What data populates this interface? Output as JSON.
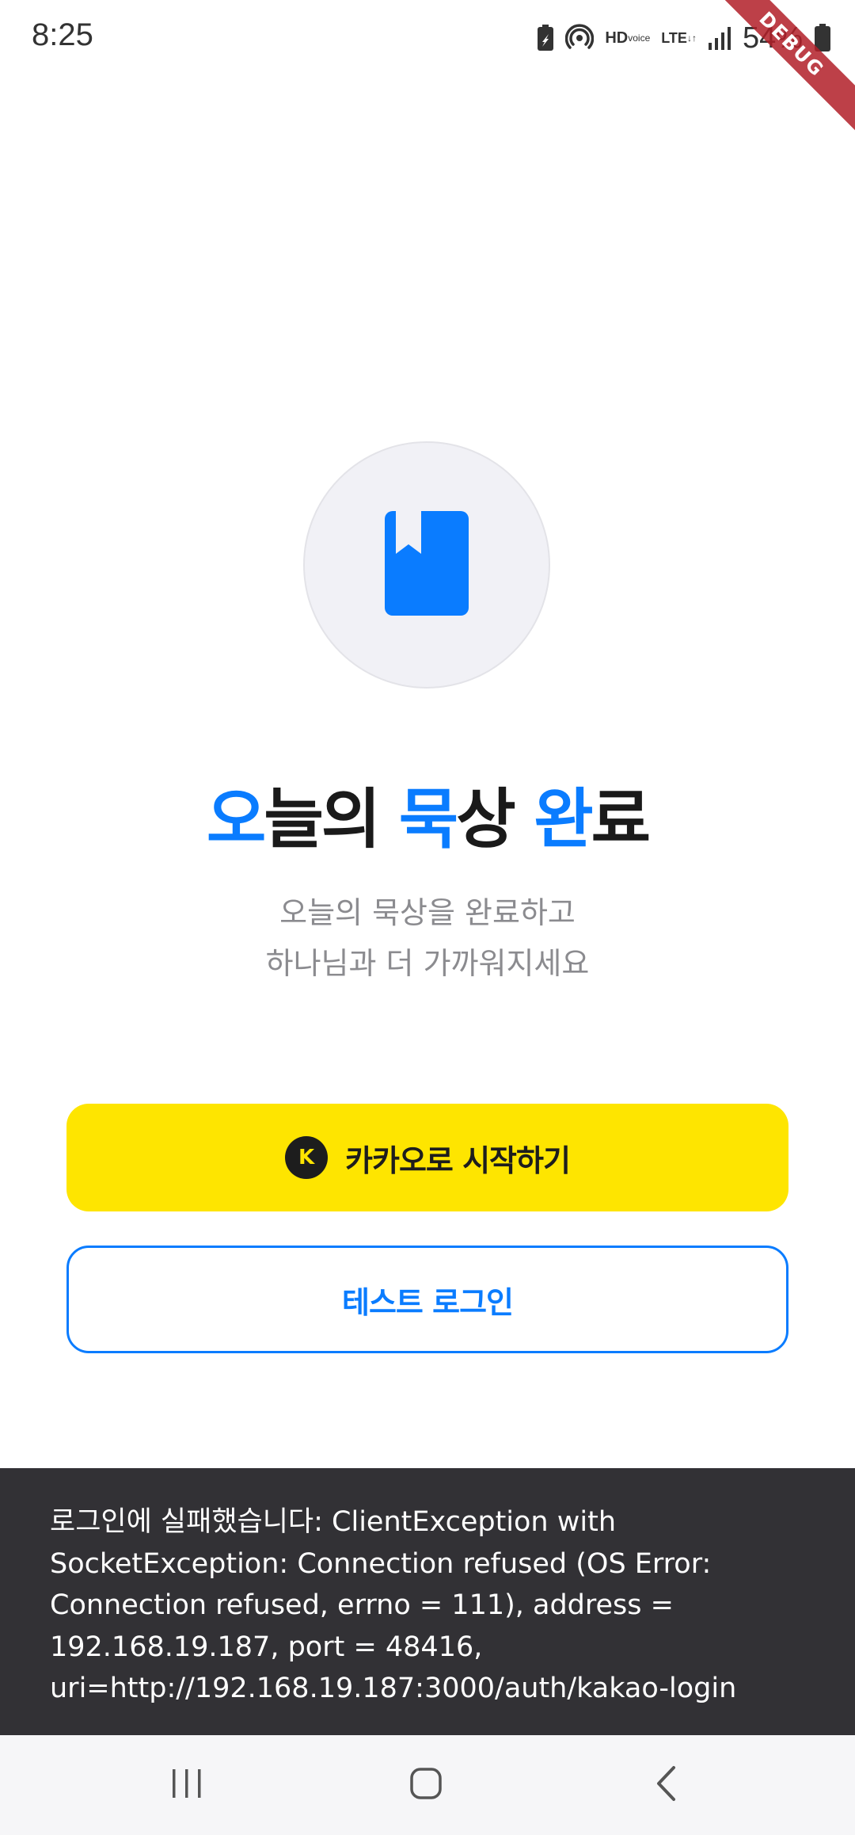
{
  "status_bar": {
    "time": "8:25",
    "hd_voice_top": "HD",
    "hd_voice_bottom": "voice",
    "lte": "LTE",
    "battery": "54%"
  },
  "debug_banner": "DEBUG",
  "logo": {
    "icon": "book-bookmark-icon",
    "color": "#0a7cff"
  },
  "title": {
    "parts": [
      {
        "text": "오",
        "accent": true
      },
      {
        "text": "늘의 ",
        "accent": false
      },
      {
        "text": "묵",
        "accent": true
      },
      {
        "text": "상 ",
        "accent": false
      },
      {
        "text": "완",
        "accent": true
      },
      {
        "text": "료",
        "accent": false
      }
    ]
  },
  "subtitle": {
    "line1": "오늘의 묵상을 완료하고",
    "line2": "하나님과 더 가까워지세요"
  },
  "kakao_button": {
    "icon_letter": "K",
    "label": "카카오로 시작하기",
    "background": "#fee500"
  },
  "test_button": {
    "label": "테스트 로그인",
    "color": "#0a7cff"
  },
  "snackbar": {
    "message": "로그인에 실패했습니다: ClientException with SocketException: Connection refused (OS Error: Connection refused, errno = 111), address = 192.168.19.187, port = 48416, uri=http://192.168.19.187:3000/auth/kakao-login"
  },
  "nav_bar": {
    "recents_icon": "recent-apps-icon",
    "home_icon": "home-icon",
    "back_icon": "back-icon"
  }
}
